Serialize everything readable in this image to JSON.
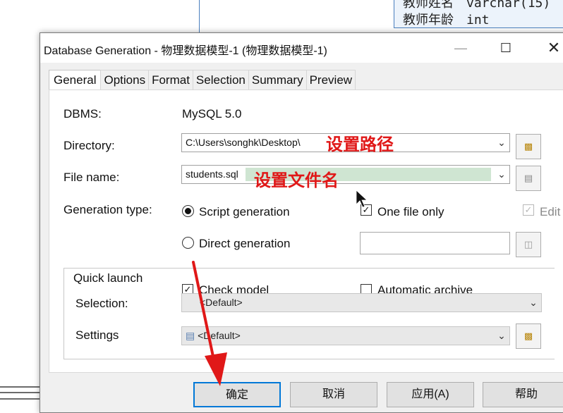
{
  "background": {
    "table_rows": [
      {
        "name": "教师姓名",
        "type": "varchar(15)"
      },
      {
        "name": "教师年龄",
        "type": "int"
      }
    ]
  },
  "dialog": {
    "title": "Database Generation - 物理数据模型-1 (物理数据模型-1)",
    "controls": {
      "minimize": "—",
      "maximize": "☐",
      "close": "✕"
    }
  },
  "tabs": [
    {
      "label": "General",
      "active": true
    },
    {
      "label": "Options",
      "active": false
    },
    {
      "label": "Format",
      "active": false
    },
    {
      "label": "Selection",
      "active": false
    },
    {
      "label": "Summary",
      "active": false
    },
    {
      "label": "Preview",
      "active": false
    }
  ],
  "general": {
    "dbms_label": "DBMS:",
    "dbms_value": "MySQL 5.0",
    "directory_label": "Directory:",
    "directory_value": "C:\\Users\\songhk\\Desktop\\",
    "filename_label": "File name:",
    "filename_value": "students.sql",
    "generation_type_label": "Generation type:",
    "script_generation": "Script generation",
    "script_generation_selected": true,
    "direct_generation": "Direct generation",
    "direct_generation_selected": false,
    "one_file_only": "One file only",
    "one_file_only_checked": true,
    "edit_label": "Edit",
    "edit_checked": true
  },
  "quick_launch": {
    "title": "Quick launch",
    "check_model": "Check model",
    "check_model_checked": true,
    "automatic_archive": "Automatic archive",
    "automatic_archive_checked": false,
    "selection_label": "Selection:",
    "selection_value": "<Default>",
    "settings_label": "Settings",
    "settings_value": "<Default>"
  },
  "annotations": {
    "path": "设置路径",
    "filename": "设置文件名"
  },
  "buttons": {
    "ok": "确定",
    "cancel": "取消",
    "apply": "应用(A)",
    "help": "帮助"
  },
  "colors": {
    "annotation_red": "#e01818",
    "selection_highlight": "#cfe5d2",
    "primary_border": "#0078d7"
  }
}
